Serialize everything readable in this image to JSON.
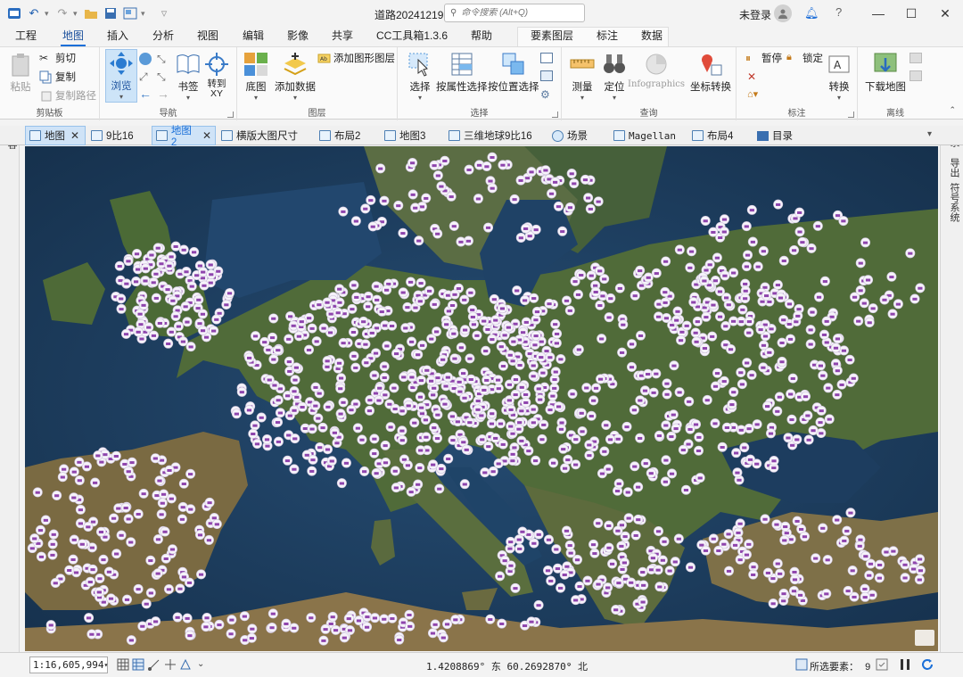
{
  "window": {
    "title": "道路20241219",
    "search_placeholder": "命令搜索 (Alt+Q)",
    "login": "未登录",
    "minimize": "—",
    "maximize": "☐",
    "close": "✕"
  },
  "menu_tabs": [
    "工程",
    "地图",
    "插入",
    "分析",
    "视图",
    "编辑",
    "影像",
    "共享",
    "CC工具箱1.3.6",
    "帮助",
    "要素图层",
    "标注",
    "数据"
  ],
  "active_menu_tab": "地图",
  "ribbon": {
    "clipboard": {
      "label": "剪贴板",
      "paste": "粘贴",
      "cut": "剪切",
      "copy": "复制",
      "copy_path": "复制路径"
    },
    "navigate": {
      "label": "导航",
      "explore": "浏览",
      "bookmarks": "书签",
      "goto_xy": "转到\nXY"
    },
    "layer": {
      "label": "图层",
      "basemap": "底图",
      "add_data": "添加数据",
      "add_graphics": "添加图形图层"
    },
    "selection": {
      "label": "选择",
      "select": "选择",
      "select_by_attr": "按属性选择",
      "select_by_loc": "按位置选择"
    },
    "inquiry": {
      "label": "查询",
      "measure": "测量",
      "locate": "定位",
      "infographics": "Infographics",
      "coord_conv": "坐标转换"
    },
    "labeling": {
      "label": "标注",
      "pause": "暂停",
      "lock": "锁定",
      "convert": "转换"
    },
    "offline": {
      "label": "离线",
      "download_map": "下载地图"
    }
  },
  "view_tabs": [
    {
      "label": "地图",
      "active": true,
      "closable": true
    },
    {
      "label": "9比16",
      "active": false,
      "closable": false
    },
    {
      "label": "地图2",
      "active": true,
      "closable": true
    },
    {
      "label": "横版大图尺寸",
      "active": false,
      "closable": false
    },
    {
      "label": "布局2",
      "active": false,
      "closable": false
    },
    {
      "label": "地图3",
      "active": false,
      "closable": false
    },
    {
      "label": "三维地球9比16",
      "active": false,
      "closable": false
    },
    {
      "label": "场景",
      "active": false,
      "closable": false
    },
    {
      "label": "Magellan",
      "active": false,
      "closable": false
    },
    {
      "label": "布局4",
      "active": false,
      "closable": false
    },
    {
      "label": "目录",
      "active": false,
      "closable": false
    }
  ],
  "side_panels": {
    "left": "内容",
    "right": [
      "目录",
      "导出",
      "符号系统"
    ]
  },
  "status": {
    "scale": "1:16,605,994",
    "coordinates": "1.4208869° 东 60.2692870° 北",
    "selected_label": "所选要素：",
    "selected_count": "9"
  },
  "colors": {
    "accent": "#1a6fd8",
    "marker": "#8e44ad",
    "sea": "#1f3f63",
    "land": "#4e6b36"
  }
}
